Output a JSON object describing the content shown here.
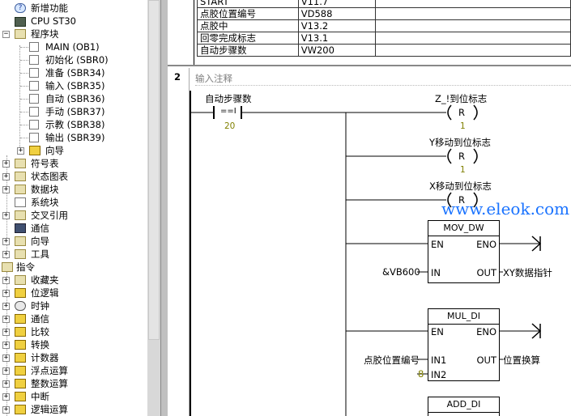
{
  "tree": {
    "items": [
      {
        "label": "新增功能",
        "icon": "help-icon"
      },
      {
        "label": "CPU ST30",
        "icon": "cpu-icon"
      },
      {
        "label": "程序块",
        "icon": "program-block-icon"
      },
      {
        "label": "MAIN (OB1)",
        "icon": "program-icon"
      },
      {
        "label": "初始化 (SBR0)",
        "icon": "program-icon"
      },
      {
        "label": "准备 (SBR34)",
        "icon": "program-icon"
      },
      {
        "label": "输入 (SBR35)",
        "icon": "program-icon"
      },
      {
        "label": "自动 (SBR36)",
        "icon": "program-icon"
      },
      {
        "label": "手动 (SBR37)",
        "icon": "program-icon"
      },
      {
        "label": "示教 (SBR38)",
        "icon": "program-icon"
      },
      {
        "label": "输出 (SBR39)",
        "icon": "program-icon"
      },
      {
        "label": "向导",
        "icon": "wizard-icon"
      },
      {
        "label": "符号表",
        "icon": "folder-icon"
      },
      {
        "label": "状态图表",
        "icon": "folder-icon"
      },
      {
        "label": "数据块",
        "icon": "folder-icon"
      },
      {
        "label": "系统块",
        "icon": "system-block-icon"
      },
      {
        "label": "交叉引用",
        "icon": "folder-icon"
      },
      {
        "label": "通信",
        "icon": "communication-icon"
      },
      {
        "label": "向导",
        "icon": "folder-icon"
      },
      {
        "label": "工具",
        "icon": "folder-icon"
      },
      {
        "label": "指令",
        "icon": "instructions-icon"
      },
      {
        "label": "收藏夹",
        "icon": "folder-icon"
      },
      {
        "label": "位逻辑",
        "icon": "bit-logic-icon"
      },
      {
        "label": "时钟",
        "icon": "clock-icon"
      },
      {
        "label": "通信",
        "icon": "communication-icon"
      },
      {
        "label": "比较",
        "icon": "compare-icon"
      },
      {
        "label": "转换",
        "icon": "convert-icon"
      },
      {
        "label": "计数器",
        "icon": "counter-icon"
      },
      {
        "label": "浮点运算",
        "icon": "float-math-icon"
      },
      {
        "label": "整数运算",
        "icon": "int-math-icon"
      },
      {
        "label": "中断",
        "icon": "interrupt-icon"
      },
      {
        "label": "逻辑运算",
        "icon": "logic-op-icon"
      }
    ]
  },
  "symtable": {
    "rows": [
      {
        "name": "START",
        "addr": "V11.7"
      },
      {
        "name": "点胶位置编号",
        "addr": "VD588"
      },
      {
        "name": "点胶中",
        "addr": "V13.2"
      },
      {
        "name": "回零完成标志",
        "addr": "V13.1"
      },
      {
        "name": "自动步骤数",
        "addr": "VW200"
      }
    ]
  },
  "network": {
    "number": "2",
    "comment": "输入注释",
    "contact": {
      "label": "自动步骤数",
      "op": "==I",
      "value": "20"
    },
    "coils": [
      {
        "label": "Z_!到位标志",
        "type": "R",
        "count": "1"
      },
      {
        "label": "Y移动到位标志",
        "type": "R",
        "count": "1"
      },
      {
        "label": "X移动到位标志",
        "type": "R",
        "count": ""
      }
    ],
    "watermark": "www.eleok.com",
    "boxes": [
      {
        "title": "MOV_DW",
        "en": "EN",
        "eno": "ENO",
        "in1": "IN",
        "out": "OUT",
        "in1_val": "&VB600",
        "out_val": "XY数据指针"
      },
      {
        "title": "MUL_DI",
        "en": "EN",
        "eno": "ENO",
        "in1": "IN1",
        "in2": "IN2",
        "out": "OUT",
        "in1_val": "点胶位置编号",
        "in2_val": "8",
        "out_val": "位置换算"
      },
      {
        "title": "ADD_DI"
      }
    ]
  }
}
